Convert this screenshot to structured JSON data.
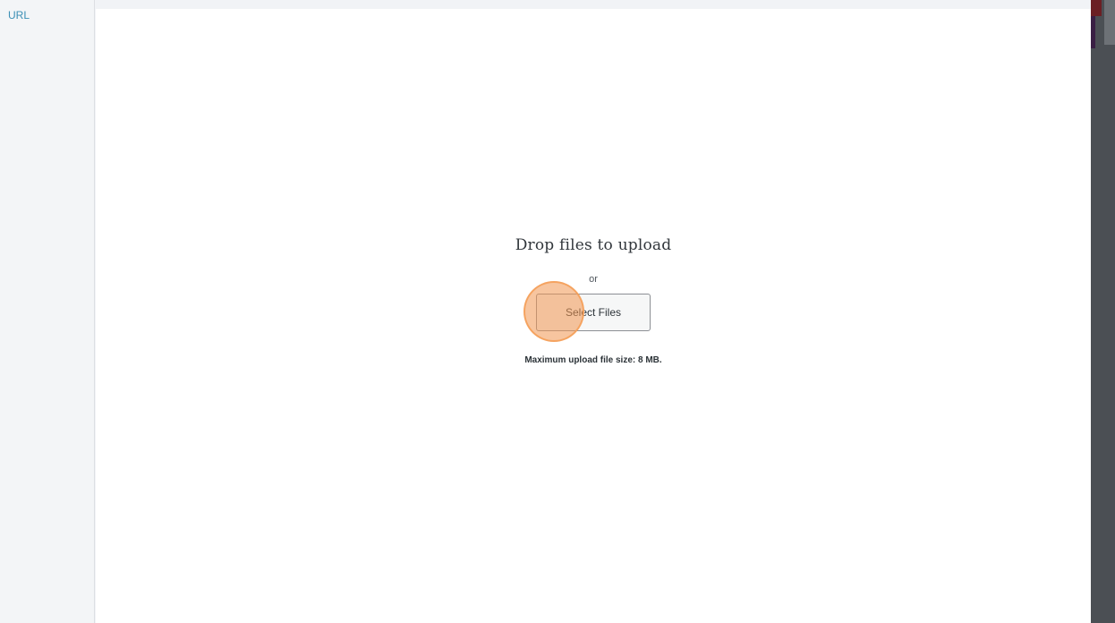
{
  "sidebar": {
    "url_link": "URL"
  },
  "upload": {
    "title": "Drop files to upload",
    "or_text": "or",
    "select_button": "Select Files",
    "max_size_text": "Maximum upload file size: 8 MB."
  },
  "colors": {
    "link": "#3b8fb5",
    "click_indicator": "#f0a060",
    "overlay": "#4b4f54"
  }
}
